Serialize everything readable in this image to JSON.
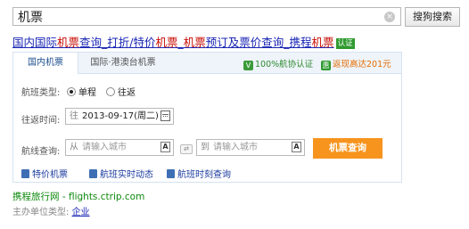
{
  "search": {
    "query": "机票",
    "button_label": "搜狗搜索",
    "clear_glyph": "×"
  },
  "result": {
    "title_parts": [
      {
        "text": "国内国际",
        "hl": false
      },
      {
        "text": "机票",
        "hl": true
      },
      {
        "text": "查询_打折/特价",
        "hl": false
      },
      {
        "text": "机票",
        "hl": true
      },
      {
        "text": "_",
        "hl": false
      },
      {
        "text": "机票",
        "hl": true
      },
      {
        "text": "预订及票价查询_携程",
        "hl": false
      },
      {
        "text": "机票",
        "hl": true
      }
    ],
    "badge": "认证"
  },
  "widget": {
    "tabs": [
      {
        "label": "国内机票",
        "active": true
      },
      {
        "label": "国际·港澳台机票",
        "active": false
      }
    ],
    "verify_icon": "V",
    "verify_text": "100%航协认证",
    "cash_icon": "惠",
    "cash_text": "返现高达201元",
    "trip_type": {
      "label": "航班类型:",
      "options": [
        {
          "label": "单程",
          "selected": true
        },
        {
          "label": "往返",
          "selected": false
        }
      ]
    },
    "date": {
      "label": "往返时间:",
      "prefix": "往",
      "value": "2013-09-17(周二)"
    },
    "route": {
      "label": "航线查询:",
      "from_prefix": "从",
      "from_placeholder": "请输入城市",
      "to_prefix": "到",
      "to_placeholder": "请输入城市",
      "input_icon": "A",
      "swap_glyph": "⇄"
    },
    "query_button": "机票查询",
    "quick_links": [
      "特价机票",
      "航班实时动态",
      "航班时刻查询"
    ]
  },
  "footer": {
    "site": "携程旅行网 - flights.ctrip.com",
    "sponsor_label": "主办单位类型:",
    "sponsor_link": "企业"
  },
  "colors": {
    "link": "#1a26b5",
    "highlight": "#c60a00",
    "accent_orange": "#f7941e",
    "green": "#0f8a0f"
  }
}
